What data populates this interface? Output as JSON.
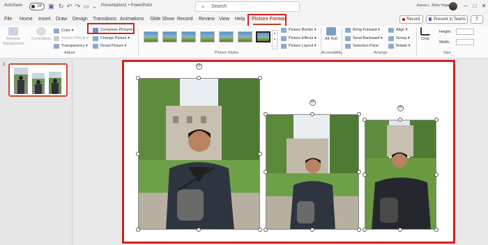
{
  "titlebar": {
    "autosave": "AutoSave",
    "toggle": "Off",
    "doc_title": "Presentation1 • PowerPoint",
    "search_placeholder": "Search",
    "user": "Josua L. Dela Vega"
  },
  "tabs": [
    "File",
    "Home",
    "Insert",
    "Draw",
    "Design",
    "Transitions",
    "Animations",
    "Slide Show",
    "Record",
    "Review",
    "View",
    "Help",
    "Picture Format"
  ],
  "active_tab": "Picture Format",
  "actions": {
    "record": "Record",
    "present": "Present in Teams"
  },
  "ribbon": {
    "remove_bg": "Remove Background",
    "corrections": "Corrections",
    "color": "Color",
    "artistic": "Artistic Effects",
    "transparency": "Transparency",
    "compress": "Compress Pictures",
    "change": "Change Picture",
    "reset": "Reset Picture",
    "adjust": "Adjust",
    "picture_styles": "Picture Styles",
    "border": "Picture Border",
    "effects": "Picture Effects",
    "layout": "Picture Layout",
    "alt_text": "Alt Text",
    "accessibility": "Accessibility",
    "bring_forward": "Bring Forward",
    "send_backward": "Send Backward",
    "selection_pane": "Selection Pane",
    "align": "Align",
    "group": "Group",
    "rotate": "Rotate",
    "arrange": "Arrange",
    "crop": "Crop",
    "height": "Height:",
    "width": "Width:",
    "size": "Size"
  },
  "pane": {
    "slide_number": "1"
  },
  "colors": {
    "accent": "#b7472a",
    "highlight": "#d32020"
  }
}
